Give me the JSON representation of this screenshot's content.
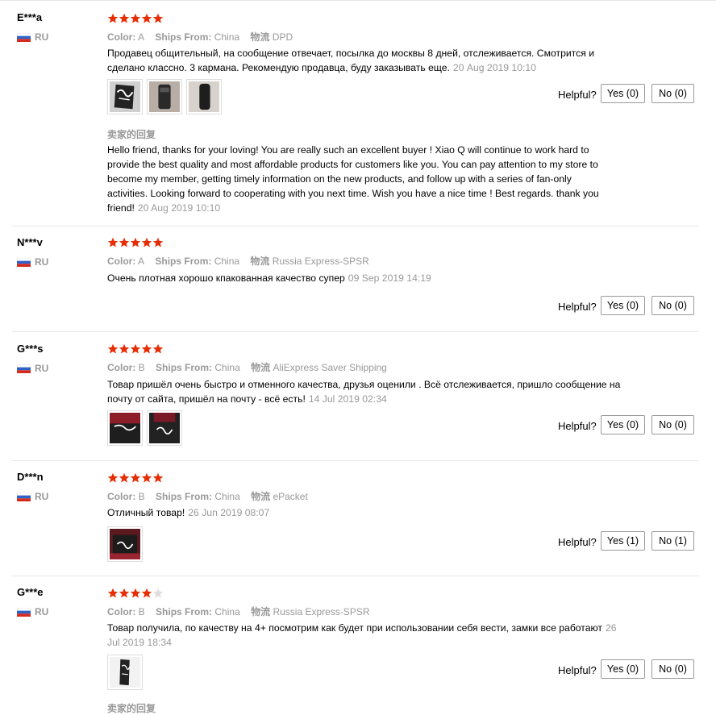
{
  "reviews": [
    {
      "user": "E***a",
      "country": "RU",
      "rating": 5,
      "color_label": "Color:",
      "color_value": "A",
      "ships_label": "Ships From:",
      "ships_value": "China",
      "shipping_label": "物流",
      "shipping_value": "DPD",
      "text": "Продавец общительный, на сообщение отвечает, посылка до москвы 8 дней, отслеживается. Смотрится и сделано классно. 3 кармана. Рекомендую продавца, буду заказывать еще.",
      "date": "20 Aug 2019 10:10",
      "helpful_label": "Helpful?",
      "yes_label": "Yes (0)",
      "no_label": "No (0)",
      "reply_title": "卖家的回复",
      "reply_text": "Hello friend, thanks for your loving! You are really such an excellent buyer ! Xiao Q will continue to work hard to provide the best quality and most affordable products for customers like you. You can pay attention to my store to become my member, getting timely information on the new products, and follow up with a series of fan-only activities. Looking forward to cooperating with you next time. Wish you have a nice time ! Best regards. thank you friend!",
      "reply_date": "20 Aug 2019 10:10"
    },
    {
      "user": "N***v",
      "country": "RU",
      "rating": 5,
      "color_label": "Color:",
      "color_value": "A",
      "ships_label": "Ships From:",
      "ships_value": "China",
      "shipping_label": "物流",
      "shipping_value": "Russia Express-SPSR",
      "text": "Очень плотная хорошо кпакованная качество супер",
      "date": "09 Sep 2019 14:19",
      "helpful_label": "Helpful?",
      "yes_label": "Yes (0)",
      "no_label": "No (0)"
    },
    {
      "user": "G***s",
      "country": "RU",
      "rating": 5,
      "color_label": "Color:",
      "color_value": "B",
      "ships_label": "Ships From:",
      "ships_value": "China",
      "shipping_label": "物流",
      "shipping_value": "AliExpress Saver Shipping",
      "text": "Товар пришёл очень быстро и отменного качества, друзья оценили . Всё отслеживается, пришло сообщение на почту от сайта, пришёл на почту - всё есть!",
      "date": "14 Jul 2019 02:34",
      "helpful_label": "Helpful?",
      "yes_label": "Yes (0)",
      "no_label": "No (0)"
    },
    {
      "user": "D***n",
      "country": "RU",
      "rating": 5,
      "color_label": "Color:",
      "color_value": "B",
      "ships_label": "Ships From:",
      "ships_value": "China",
      "shipping_label": "物流",
      "shipping_value": "ePacket",
      "text": "Отличный товар!",
      "date": "26 Jun 2019 08:07",
      "helpful_label": "Helpful?",
      "yes_label": "Yes (1)",
      "no_label": "No (1)"
    },
    {
      "user": "G***e",
      "country": "RU",
      "rating": 4,
      "color_label": "Color:",
      "color_value": "B",
      "ships_label": "Ships From:",
      "ships_value": "China",
      "shipping_label": "物流",
      "shipping_value": "Russia Express-SPSR",
      "text": "Товар получила, по качеству на 4+ посмотрим как будет при использовании себя вести, замки все работают",
      "date": "26 Jul 2019 18:34",
      "helpful_label": "Helpful?",
      "yes_label": "Yes (0)",
      "no_label": "No (0)",
      "reply_title": "卖家的回复"
    }
  ],
  "colors": {
    "star_filled": "#e62e04",
    "star_empty": "#dddddd",
    "muted_text": "#999999"
  }
}
